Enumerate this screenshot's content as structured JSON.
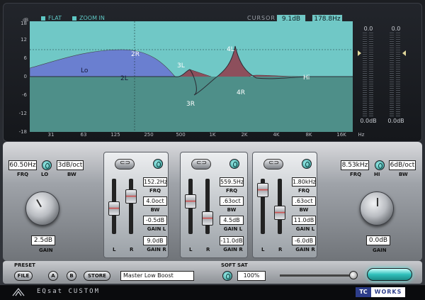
{
  "graph": {
    "options": [
      "FLAT",
      "ZOOM IN"
    ],
    "cursor_label": "CURSOR",
    "cursor_db": "9.1dB",
    "cursor_freq": "178.8Hz",
    "y_unit": "dB",
    "y_ticks": [
      "18",
      "12",
      "6",
      "0",
      "-6",
      "-12",
      "-18"
    ],
    "x_ticks": [
      "31",
      "63",
      "125",
      "250",
      "500",
      "1K",
      "2K",
      "4K",
      "8K",
      "16K"
    ],
    "x_unit": "Hz",
    "band_labels": [
      "Lo",
      "2R",
      "2L",
      "3L",
      "3R",
      "4L",
      "4R",
      "Hi"
    ],
    "colors": {
      "bg": "#70c8c6",
      "left": "#6a7fd0",
      "right": "#8d4f5c",
      "base": "#4e8f89"
    }
  },
  "meters": {
    "left_peak": "0.0",
    "right_peak": "0.0",
    "left_level": "0.0dB",
    "right_level": "0.0dB"
  },
  "low": {
    "frq": "60.50Hz",
    "bw": "3dB/oct",
    "frq_label": "FRQ",
    "bw_label": "BW",
    "toggle_label": "LO",
    "gain": "2.5dB",
    "gain_label": "GAIN"
  },
  "high": {
    "frq": "8.53kHz",
    "bw": "6dB/oct",
    "frq_label": "FRQ",
    "bw_label": "BW",
    "toggle_label": "HI",
    "gain": "0.0dB",
    "gain_label": "GAIN"
  },
  "bands": [
    {
      "frq": "152.2Hz",
      "bw": "4.0oct",
      "gain_l": "-0.5dB",
      "gain_r": "9.0dB",
      "slider_l": 0.55,
      "slider_r": 0.25
    },
    {
      "frq": "559.5Hz",
      "bw": ".63oct",
      "gain_l": "4.5dB",
      "gain_r": "-11.0dB",
      "slider_l": 0.38,
      "slider_r": 0.8
    },
    {
      "frq": "1.80kHz",
      "bw": ".63oct",
      "gain_l": "11.0dB",
      "gain_r": "-6.0dB",
      "slider_l": 0.1,
      "slider_r": 0.65
    }
  ],
  "band_labels": {
    "frq": "FRQ",
    "bw": "BW",
    "gain_l": "GAIN L",
    "gain_r": "GAIN R",
    "l": "L",
    "r": "R"
  },
  "preset": {
    "label": "PRESET",
    "file": "FILE",
    "a": "A",
    "b": "B",
    "store": "STORE",
    "name": "Master Low Boost"
  },
  "soft_sat": {
    "label": "SOFT SAT",
    "value": "100%",
    "level": 1.0
  },
  "footer": {
    "product": "EQsat CUSTOM",
    "brand_tc": "TC",
    "brand_works": "WORKS"
  }
}
